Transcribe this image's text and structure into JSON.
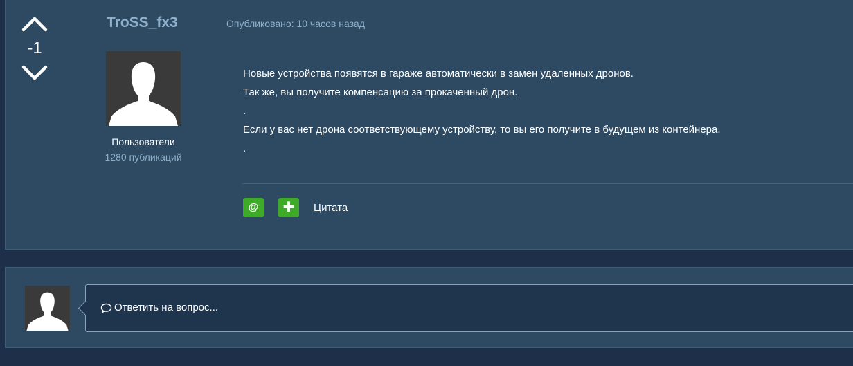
{
  "post": {
    "vote_count": "-1",
    "author": "TroSS_fx3",
    "published": "Опубликовано: 10 часов назад",
    "group": "Пользователи",
    "post_count": "1280 публикаций",
    "content_lines": [
      "Новые устройства появятся в гараже автоматически в замен удаленных дронов.",
      "Так же, вы получите компенсацию за прокаченный дрон.",
      ".",
      "Если у вас нет дрона соответствующему устройству, то вы его получите в будущем из контейнера.",
      "."
    ],
    "actions": {
      "mention_symbol": "@",
      "add_symbol": "✚",
      "quote_label": "Цитата"
    },
    "icons": {
      "vote_up": "chevron-up-icon",
      "vote_down": "chevron-down-icon",
      "avatar": "default-user-avatar"
    }
  },
  "reply": {
    "prompt": "Ответить на вопрос...",
    "prompt_icon": "speech-bubble-icon"
  },
  "colors": {
    "page_bg": "#1e3049",
    "panel_bg": "#2d4a62",
    "accent_link": "#8fb0cc",
    "action_green": "#3faa28"
  }
}
